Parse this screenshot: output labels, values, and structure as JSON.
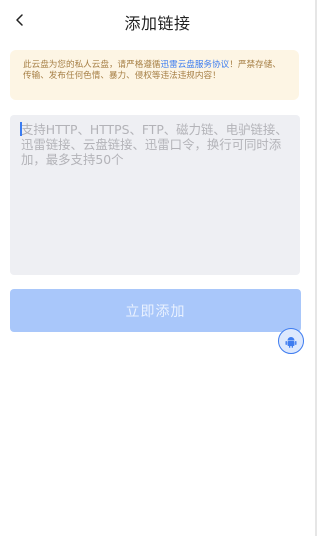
{
  "header": {
    "title": "添加链接",
    "back_icon": "chevron-left-icon"
  },
  "notice": {
    "text_before": "此云盘为您的私人云盘，请严格遵循",
    "link_text": "迅雷云盘服务协议",
    "text_after": "！严禁存储、传输、发布任何色情、暴力、侵权等违法违规内容！"
  },
  "input": {
    "placeholder": "支持HTTP、HTTPS、FTP、磁力链、电驴链接、迅雷链接、云盘链接、迅雷口令，换行可同时添加，最多支持50个",
    "value": ""
  },
  "submit": {
    "label": "立即添加",
    "state": "disabled"
  },
  "floating_button": {
    "icon": "android-icon"
  },
  "colors": {
    "accent": "#3b7cf1",
    "notice_bg": "#fdf5e4",
    "notice_text": "#a67f45",
    "button_disabled": "#a9c7fa",
    "input_bg": "#eeeff3"
  }
}
